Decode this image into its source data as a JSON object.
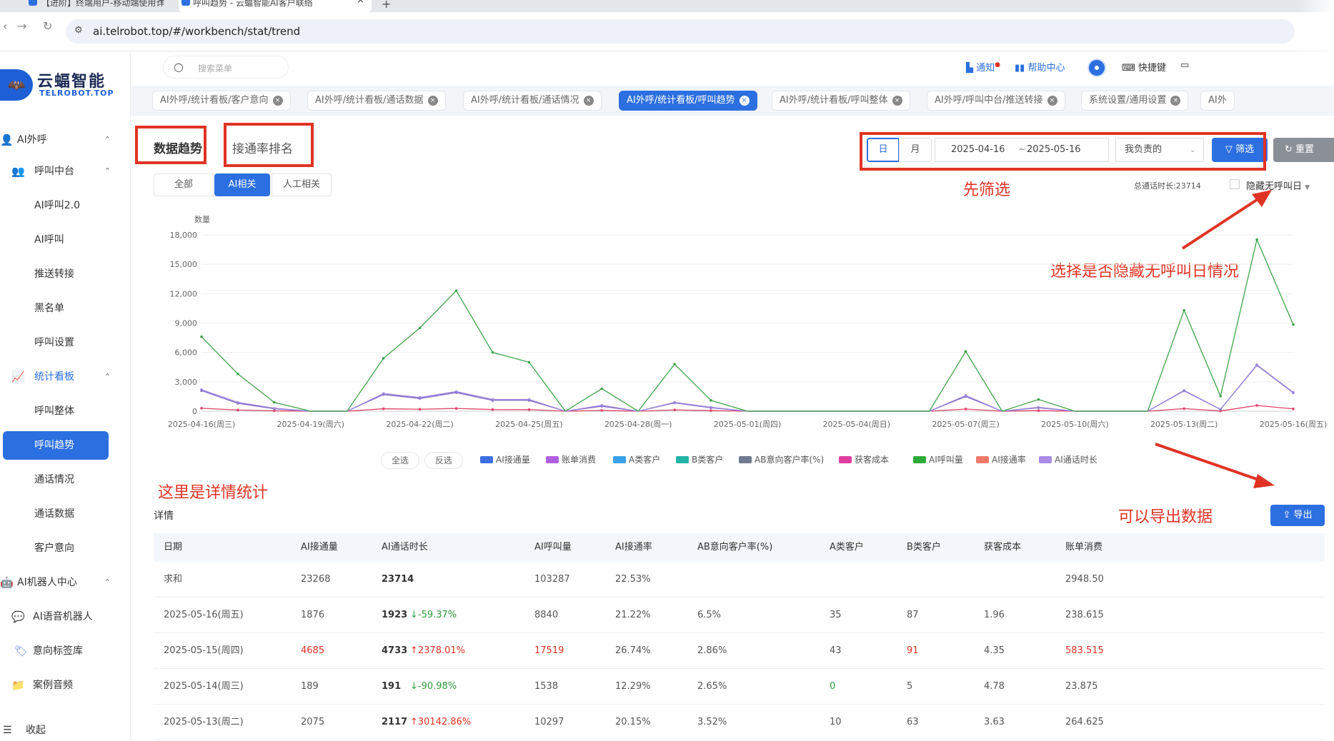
{
  "browser": {
    "tabs": [
      {
        "title": "【进阶】终端用户-移动端使用详"
      },
      {
        "title": "呼叫趋势 - 云蝠智能AI客户联络"
      }
    ],
    "url": "ai.telrobot.top/#/workbench/stat/trend"
  },
  "logo": {
    "name": "云蝠智能",
    "sub": "TELROBOT.TOP"
  },
  "sidebar": {
    "items": [
      {
        "label": "AI外呼"
      },
      {
        "label": "呼叫中台"
      },
      {
        "label": "AI呼叫2.0"
      },
      {
        "label": "AI呼叫"
      },
      {
        "label": "推送转接"
      },
      {
        "label": "黑名单"
      },
      {
        "label": "呼叫设置"
      },
      {
        "label": "统计看板"
      },
      {
        "label": "呼叫整体"
      },
      {
        "label": "呼叫趋势"
      },
      {
        "label": "通话情况"
      },
      {
        "label": "通话数据"
      },
      {
        "label": "客户意向"
      },
      {
        "label": "AI机器人中心"
      },
      {
        "label": "AI语音机器人"
      },
      {
        "label": "意向标签库"
      },
      {
        "label": "案例音频"
      }
    ],
    "collapse": "收起"
  },
  "header": {
    "search_placeholder": "搜索菜单",
    "notify": "通知",
    "help": "帮助中心",
    "shortcut": "快捷键"
  },
  "page_tabs": [
    "AI外呼/统计看板/客户意向",
    "AI外呼/统计看板/通话数据",
    "AI外呼/统计看板/通话情况",
    "AI外呼/统计看板/呼叫趋势",
    "AI外呼/统计看板/呼叫整体",
    "AI外呼/呼叫中台/推送转接",
    "系统设置/通用设置",
    "AI外"
  ],
  "main": {
    "title_trend": "数据趋势",
    "title_rank": "接通率排名",
    "seg": [
      "全部",
      "AI相关",
      "人工相关"
    ],
    "day": "日",
    "month": "月",
    "date_start": "2025-04-16",
    "date_sep": "~",
    "date_end": "2025-05-16",
    "owner": "我负责的",
    "filter": "筛选",
    "reset": "重置",
    "total": "总通话时长:23714",
    "hide_label": "隐藏无呼叫日",
    "select_all": "全选",
    "invert": "反选",
    "detail": "详情",
    "export": "导出"
  },
  "annotations": {
    "filter_first": "先筛选",
    "hide_note": "选择是否隐藏无呼叫日情况",
    "detail_note": "这里是详情统计",
    "export_note": "可以导出数据"
  },
  "chart_data": {
    "type": "line",
    "ylabel": "数量",
    "ylim": [
      0,
      18000
    ],
    "yticks": [
      "18,000",
      "15,000",
      "12,000",
      "9,000",
      "6,000",
      "3,000",
      "0"
    ],
    "x": [
      "2025-04-16(周三)",
      "2025-04-17",
      "2025-04-18",
      "2025-04-19(周六)",
      "2025-04-20",
      "2025-04-21",
      "2025-04-22(周二)",
      "2025-04-23",
      "2025-04-24",
      "2025-04-25(周五)",
      "2025-04-26",
      "2025-04-27",
      "2025-04-28(周一)",
      "2025-04-29",
      "2025-04-30",
      "2025-05-01(周四)",
      "2025-05-02",
      "2025-05-03",
      "2025-05-04(周日)",
      "2025-05-05",
      "2025-05-06",
      "2025-05-07(周三)",
      "2025-05-08",
      "2025-05-09",
      "2025-05-10(周六)",
      "2025-05-11",
      "2025-05-12",
      "2025-05-13(周二)",
      "2025-05-14",
      "2025-05-15",
      "2025-05-16(周五)"
    ],
    "xtick_labels": [
      "2025-04-16(周三)",
      "2025-04-19(周六)",
      "2025-04-22(周二)",
      "2025-04-25(周五)",
      "2025-04-28(周一)",
      "2025-05-01(周四)",
      "2025-05-04(周日)",
      "2025-05-07(周三)",
      "2025-05-10(周六)",
      "2025-05-13(周二)",
      "2025-05-16(周五)"
    ],
    "legend": [
      {
        "name": "AI接通量",
        "color": "#3d6fe0"
      },
      {
        "name": "账单消费",
        "color": "#b05fe0"
      },
      {
        "name": "A类客户",
        "color": "#3aa0e8"
      },
      {
        "name": "B类客户",
        "color": "#22b3a5"
      },
      {
        "name": "AB意向客户率(%)",
        "color": "#6f7a90"
      },
      {
        "name": "获客成本",
        "color": "#e03da0"
      },
      {
        "name": "AI呼叫量",
        "color": "#2eaa3a"
      },
      {
        "name": "AI接通率",
        "color": "#f07a6a"
      },
      {
        "name": "AI通话时长",
        "color": "#a98be6"
      }
    ],
    "series": [
      {
        "name": "AI呼叫量",
        "color": "#3fa44a",
        "values": [
          7600,
          3800,
          900,
          0,
          0,
          5400,
          8500,
          12300,
          6000,
          5000,
          0,
          2300,
          0,
          4800,
          1100,
          0,
          0,
          0,
          0,
          0,
          0,
          6100,
          0,
          1200,
          0,
          0,
          0,
          10300,
          1538,
          17519,
          8840
        ]
      },
      {
        "name": "AI通话时长",
        "color": "#9b86d8",
        "values": [
          2200,
          900,
          300,
          0,
          0,
          1800,
          1400,
          2000,
          1200,
          1200,
          0,
          600,
          0,
          900,
          400,
          0,
          0,
          0,
          0,
          0,
          0,
          1600,
          0,
          400,
          0,
          0,
          0,
          2117,
          191,
          4733,
          1923
        ]
      },
      {
        "name": "AI接通量",
        "color": "#7f68c9",
        "values": [
          2100,
          800,
          250,
          0,
          0,
          1700,
          1300,
          1900,
          1100,
          1100,
          0,
          500,
          0,
          850,
          350,
          0,
          0,
          0,
          0,
          0,
          0,
          1500,
          0,
          350,
          0,
          0,
          0,
          2075,
          189,
          4685,
          1876
        ]
      },
      {
        "name": "账单消费",
        "color": "#e0426a",
        "values": [
          300,
          120,
          40,
          0,
          0,
          250,
          200,
          280,
          170,
          160,
          0,
          80,
          0,
          130,
          60,
          0,
          0,
          0,
          0,
          0,
          0,
          220,
          0,
          60,
          0,
          0,
          0,
          265,
          24,
          584,
          239
        ]
      }
    ]
  },
  "table": {
    "columns": [
      "日期",
      "AI接通量",
      "AI通话时长",
      "AI呼叫量",
      "AI接通率",
      "AB意向客户率(%)",
      "A类客户",
      "B类客户",
      "获客成本",
      "账单消费"
    ],
    "rows": [
      {
        "date": "求和",
        "conn": "23268",
        "dur": "23714",
        "dur_chg": "",
        "calls": "103287",
        "rate": "22.53%",
        "ab": "",
        "a": "",
        "b": "",
        "cost": "",
        "bill": "2948.50",
        "hi": false,
        "up": false
      },
      {
        "date": "2025-05-16(周五)",
        "conn": "1876",
        "dur": "1923",
        "dur_chg": "↓-59.37%",
        "calls": "8840",
        "rate": "21.22%",
        "ab": "6.5%",
        "a": "35",
        "b": "87",
        "cost": "1.96",
        "bill": "238.615",
        "hi": false,
        "up": false
      },
      {
        "date": "2025-05-15(周四)",
        "conn": "4685",
        "dur": "4733",
        "dur_chg": "↑2378.01%",
        "calls": "17519",
        "rate": "26.74%",
        "ab": "2.86%",
        "a": "43",
        "b": "91",
        "cost": "4.35",
        "bill": "583.515",
        "hi": true,
        "up": true
      },
      {
        "date": "2025-05-14(周三)",
        "conn": "189",
        "dur": "191",
        "dur_chg": "↓-90.98%",
        "calls": "1538",
        "rate": "12.29%",
        "ab": "2.65%",
        "a": "0",
        "b": "5",
        "cost": "4.78",
        "bill": "23.875",
        "hi": false,
        "up": false,
        "a_green": true
      },
      {
        "date": "2025-05-13(周二)",
        "conn": "2075",
        "dur": "2117",
        "dur_chg": "↑30142.86%",
        "calls": "10297",
        "rate": "20.15%",
        "ab": "3.52%",
        "a": "10",
        "b": "63",
        "cost": "3.63",
        "bill": "264.625",
        "hi": false,
        "up": true
      }
    ]
  }
}
